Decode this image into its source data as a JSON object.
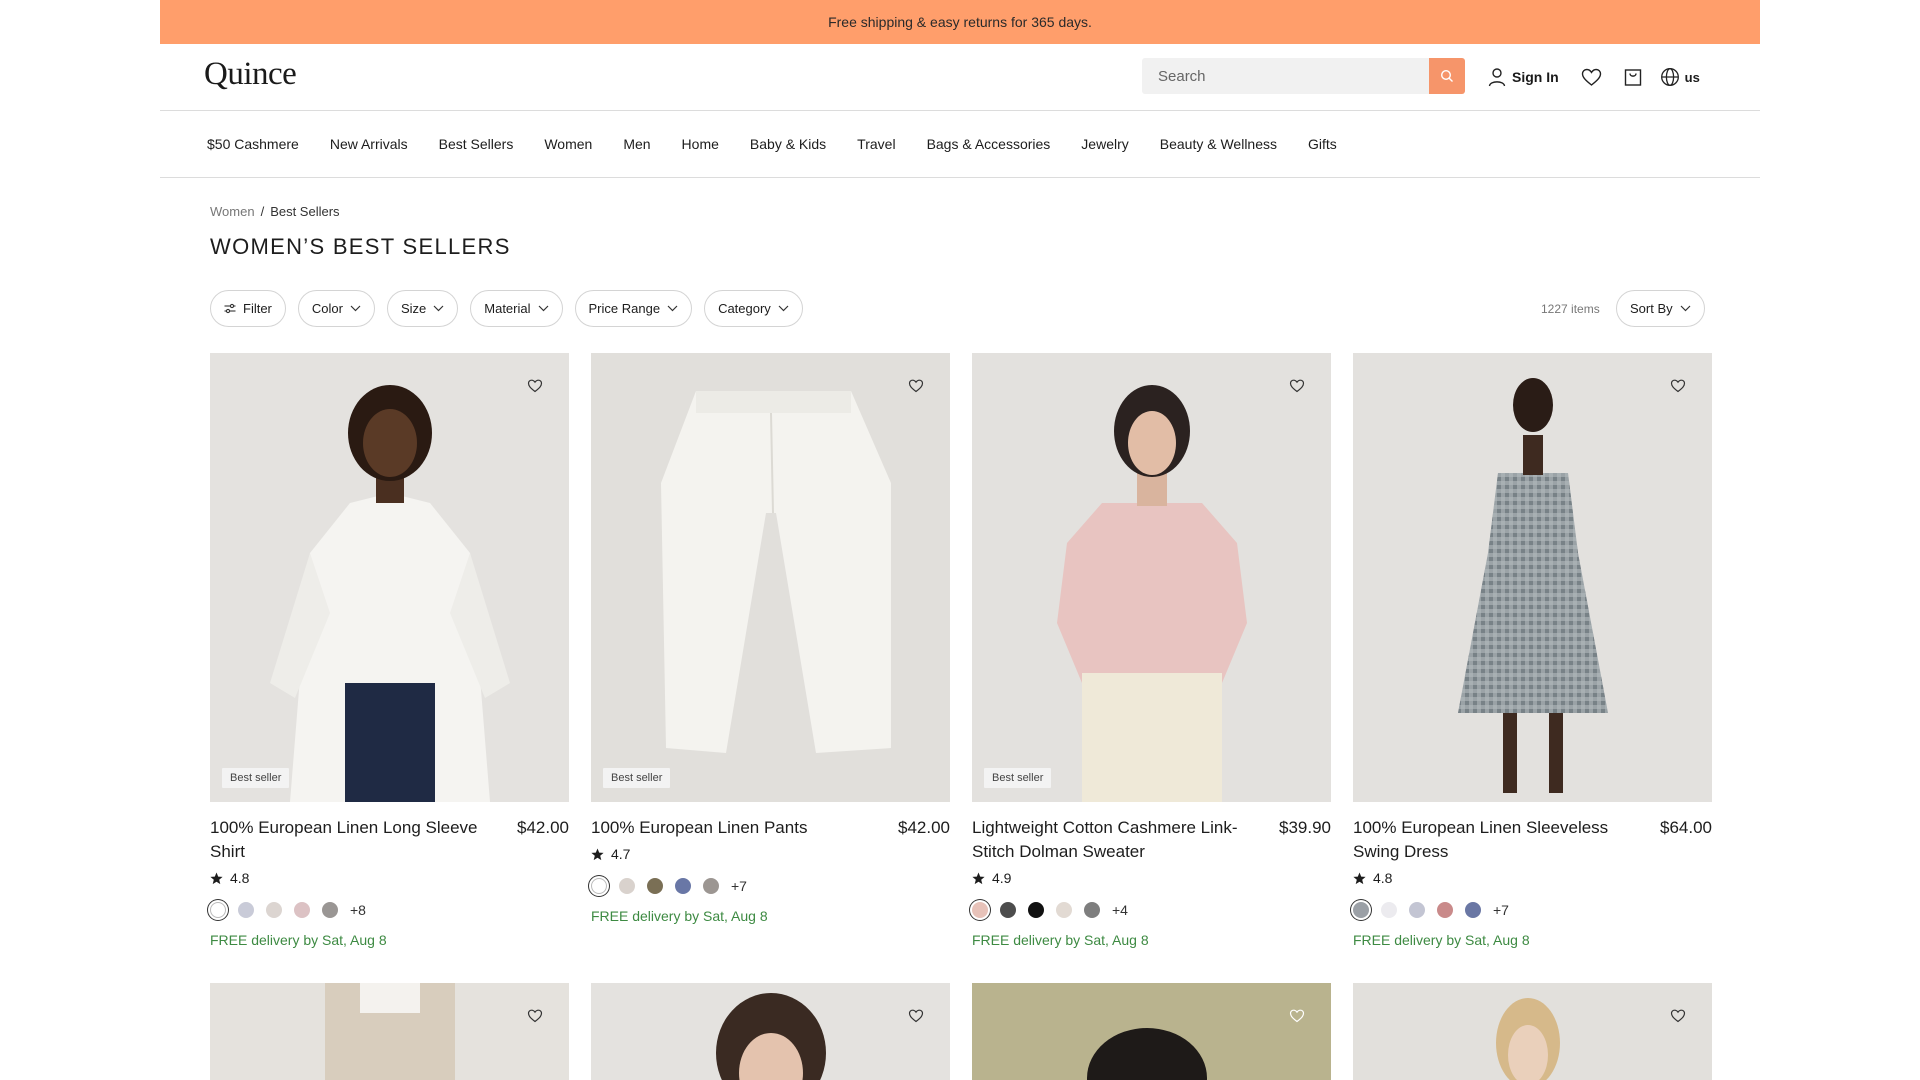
{
  "announcement": "Free shipping & easy returns for 365 days.",
  "header": {
    "logo": "Quince",
    "search_placeholder": "Search",
    "sign_in": "Sign In",
    "locale": "us"
  },
  "nav": [
    "$50 Cashmere",
    "New Arrivals",
    "Best Sellers",
    "Women",
    "Men",
    "Home",
    "Baby & Kids",
    "Travel",
    "Bags & Accessories",
    "Jewelry",
    "Beauty & Wellness",
    "Gifts"
  ],
  "breadcrumb": {
    "parent": "Women",
    "separator": "/",
    "current": "Best Sellers"
  },
  "title": "WOMEN’S BEST SELLERS",
  "filters": {
    "filter": "Filter",
    "color": "Color",
    "size": "Size",
    "material": "Material",
    "price_range": "Price Range",
    "category": "Category",
    "items_count": "1227 items",
    "sort": "Sort By"
  },
  "colors": {
    "accent": "#ff9e6b",
    "search_button": "#f6956a",
    "delivery_green": "#3d8a42"
  },
  "products": [
    {
      "name": "100% European Linen Long Sleeve Shirt",
      "price": "$42.00",
      "badge": "Best seller",
      "rating": "4.8",
      "swatches": [
        "#ffffff",
        "#c9cbd8",
        "#dcd5d1",
        "#dcc2c4",
        "#9a9694"
      ],
      "more": "+8",
      "delivery": "FREE delivery by Sat, Aug 8"
    },
    {
      "name": "100% European Linen Pants",
      "price": "$42.00",
      "badge": "Best seller",
      "rating": "4.7",
      "swatches": [
        "#ffffff",
        "#d9d2cd",
        "#7a6f55",
        "#6977a6",
        "#9c9692"
      ],
      "more": "+7",
      "delivery": "FREE delivery by Sat, Aug 8"
    },
    {
      "name": "Lightweight Cotton Cashmere Link-Stitch Dolman Sweater",
      "price": "$39.90",
      "badge": "Best seller",
      "rating": "4.9",
      "swatches": [
        "#e7c2b9",
        "#4d4d4d",
        "#111111",
        "#e2dad3",
        "#7e7e7e"
      ],
      "more": "+4",
      "delivery": "FREE delivery by Sat, Aug 8"
    },
    {
      "name": "100% European Linen Sleeveless Swing Dress",
      "price": "$64.00",
      "badge": "",
      "rating": "4.8",
      "swatches": [
        "#9ba0a6",
        "#ecebef",
        "#c3c5d3",
        "#c98a8a",
        "#6a77a4"
      ],
      "more": "+7",
      "delivery": "FREE delivery by Sat, Aug 8"
    }
  ]
}
